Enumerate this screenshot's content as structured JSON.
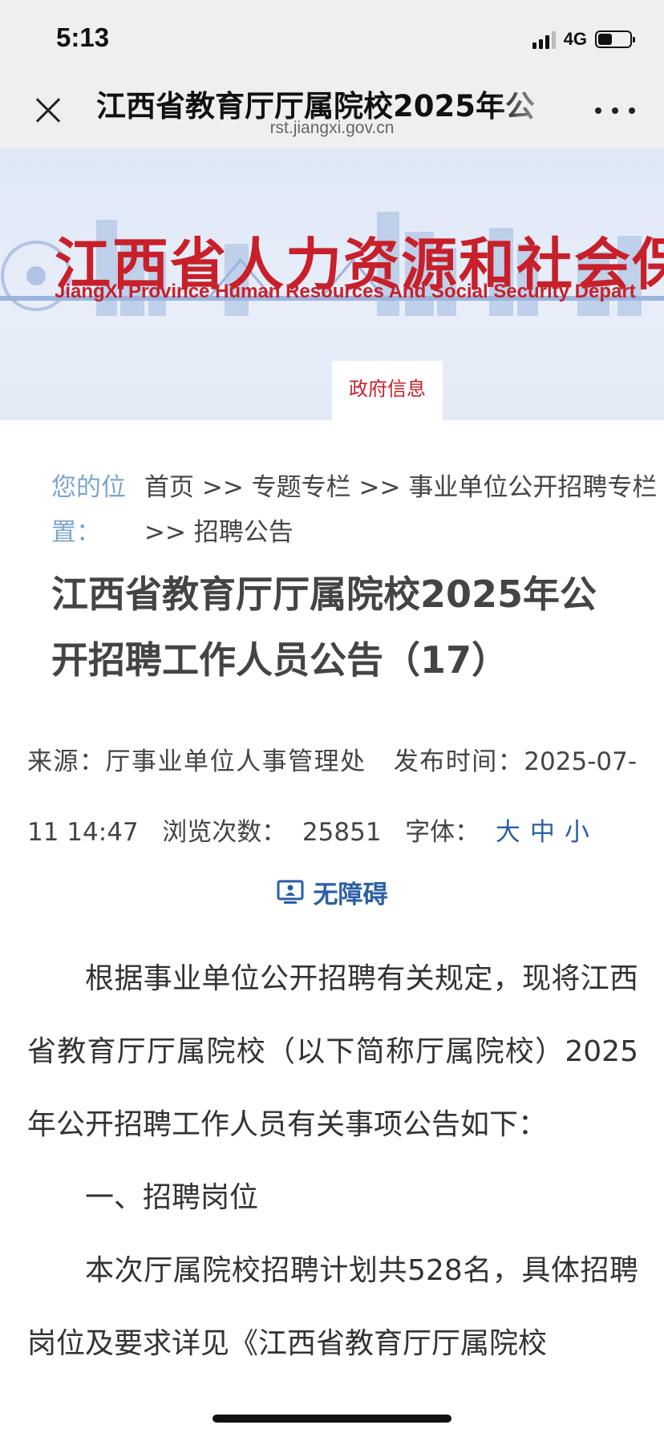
{
  "status": {
    "time": "5:13",
    "network": "4G",
    "battery_level": 0.45
  },
  "nav": {
    "title": "江西省教育厅厅属院校2025年公",
    "url": "rst.jiangxi.gov.cn"
  },
  "banner": {
    "title_cn": "江西省人力资源和社会保障",
    "title_en": "JiangXi Province Human Resources And Social Security Depart",
    "tab": "政府信息"
  },
  "breadcrumb": {
    "label": "您的位置：",
    "path": "首页 >> 专题专栏 >> 事业单位公开招聘专栏 >> 招聘公告"
  },
  "article": {
    "title": "江西省教育厅厅属院校2025年公开招聘工作人员公告（17）",
    "source_label": "来源：",
    "source": "厅事业单位人事管理处",
    "date_label": "发布时间：",
    "date": "2025-07-11 14:47",
    "views_label": "浏览次数：",
    "views": "25851",
    "font_label": "字体：",
    "font_large": "大",
    "font_medium": "中",
    "font_small": "小",
    "accessibility": "无障碍"
  },
  "content": {
    "para1": "根据事业单位公开招聘有关规定，现将江西省教育厅厅属院校（以下简称厅属院校）2025年公开招聘工作人员有关事项公告如下：",
    "section1": "一、招聘岗位",
    "para2": "本次厅属院校招聘计划共528名，具体招聘岗位及要求详见《江西省教育厅厅属院校"
  },
  "colors": {
    "brand_red": "#c8202a",
    "link_blue": "#2a5fa8",
    "label_blue": "#7da6cb"
  }
}
